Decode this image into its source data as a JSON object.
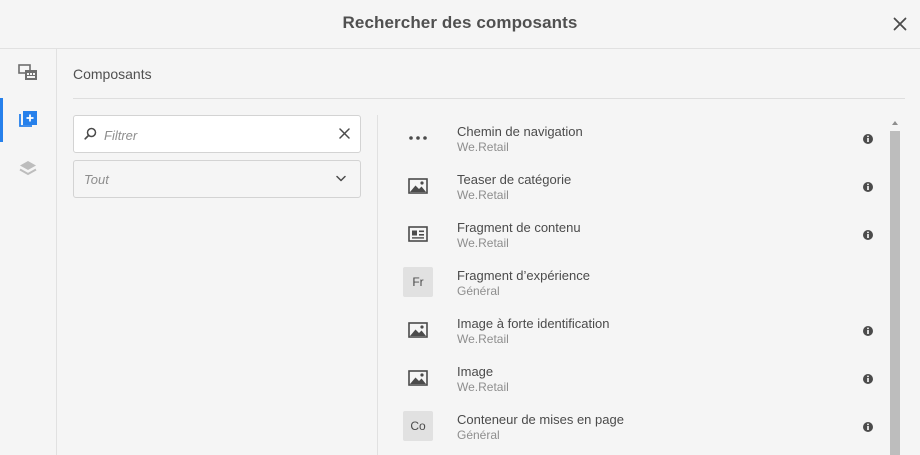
{
  "header": {
    "title": "Rechercher des composants"
  },
  "panel": {
    "title": "Composants"
  },
  "filter": {
    "placeholder": "Filtrer",
    "value": ""
  },
  "group_select": {
    "selected": "Tout"
  },
  "components": [
    {
      "name": "Chemin de navigation",
      "group": "We.Retail",
      "icon": "more-dots-icon",
      "info": true
    },
    {
      "name": "Teaser de catégorie",
      "group": "We.Retail",
      "icon": "image-icon",
      "info": true
    },
    {
      "name": "Fragment de contenu",
      "group": "We.Retail",
      "icon": "content-fragment-icon",
      "info": true
    },
    {
      "name": "Fragment d’expérience",
      "group": "Général",
      "abbr": "Fr",
      "info": false
    },
    {
      "name": "Image à forte identification",
      "group": "We.Retail",
      "icon": "image-icon",
      "info": true
    },
    {
      "name": "Image",
      "group": "We.Retail",
      "icon": "image-icon",
      "info": true
    },
    {
      "name": "Conteneur de mises en page",
      "group": "Général",
      "abbr": "Co",
      "info": true
    }
  ],
  "colors": {
    "accent": "#2680eb",
    "text": "#4b4b4b",
    "muted": "#8e8e8e",
    "background": "#f5f5f5"
  }
}
